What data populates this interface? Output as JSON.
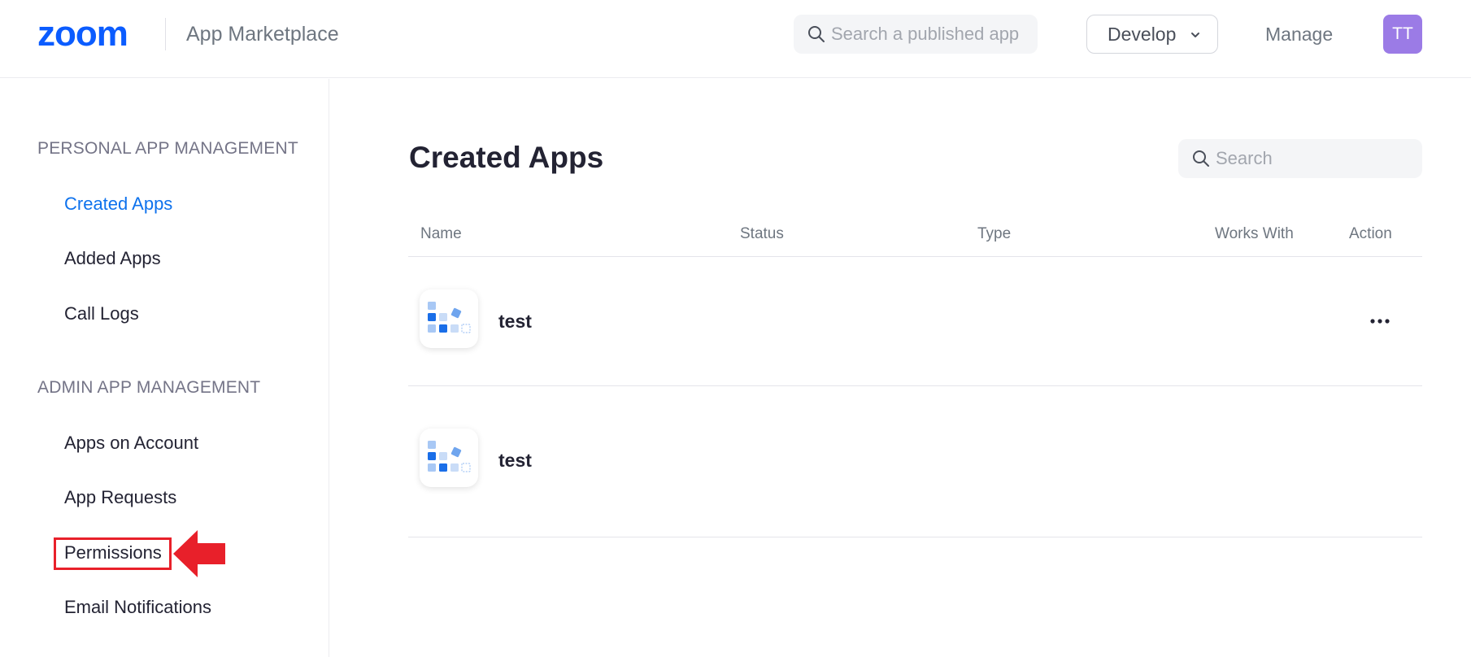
{
  "header": {
    "logo_text": "zoom",
    "app_title": "App Marketplace",
    "search_placeholder": "Search a published app",
    "develop_label": "Develop",
    "manage_label": "Manage",
    "avatar_initials": "TT",
    "brand_color": "#0b5cff",
    "avatar_color": "#9b7be6"
  },
  "sidebar": {
    "personal_title": "PERSONAL APP MANAGEMENT",
    "personal_items": [
      {
        "label": "Created Apps",
        "active": true
      },
      {
        "label": "Added Apps",
        "active": false
      },
      {
        "label": "Call Logs",
        "active": false
      }
    ],
    "admin_title": "ADMIN APP MANAGEMENT",
    "admin_items": [
      {
        "label": "Apps on Account"
      },
      {
        "label": "App Requests"
      },
      {
        "label": "Permissions",
        "highlighted": true
      },
      {
        "label": "Email Notifications"
      }
    ],
    "active_color": "#0e72ed",
    "annotation_color": "#e8202a"
  },
  "main": {
    "title": "Created Apps",
    "search_placeholder": "Search",
    "columns": [
      "Name",
      "Status",
      "Type",
      "Works With",
      "Action"
    ],
    "rows": [
      {
        "name": "test",
        "has_action_menu": true
      },
      {
        "name": "test",
        "has_action_menu": false
      }
    ]
  }
}
